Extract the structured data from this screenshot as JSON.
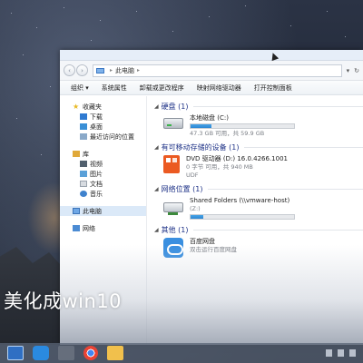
{
  "overlay_title": "美化成win10",
  "window": {
    "breadcrumb": [
      "此电脑"
    ],
    "toolbar": {
      "items": [
        "组织 ▾",
        "系统属性",
        "卸载或更改程序",
        "映射网络驱动器",
        "打开控制面板"
      ]
    },
    "sidebar": {
      "favorites": {
        "label": "收藏夹",
        "items": [
          "下载",
          "桌面",
          "最近访问的位置"
        ]
      },
      "libraries": {
        "label": "库",
        "items": [
          "视频",
          "图片",
          "文档",
          "音乐"
        ]
      },
      "this_pc": "此电脑",
      "network": "网络"
    },
    "main": {
      "hard_disks": {
        "header": "硬盘 (1)",
        "items": [
          {
            "name": "本地磁盘 (C:)",
            "usage_fraction": 0.2,
            "meta": "47.3 GB 可用，共 59.9 GB"
          }
        ]
      },
      "removable": {
        "header": "有可移动存储的设备 (1)",
        "items": [
          {
            "name": "DVD 驱动器 (D:) 16.0.4266.1001",
            "meta": "0 字节 可用，共 940 MB",
            "fs": "UDF",
            "usage_fraction": 1.0
          }
        ]
      },
      "network_locations": {
        "header": "网络位置 (1)",
        "items": [
          {
            "name": "Shared Folders (\\\\vmware-host)",
            "sub": "(Z:)",
            "usage_fraction": 0.12
          }
        ]
      },
      "other": {
        "header": "其他 (1)",
        "items": [
          {
            "name": "百度网盘",
            "sub": "双击运行百度网盘"
          }
        ]
      }
    }
  },
  "icons": {
    "back": "back-arrow-icon",
    "forward": "forward-arrow-icon",
    "refresh": "refresh-icon",
    "dropdown": "chevron-down-icon"
  },
  "colors": {
    "accent": "#2c86d3",
    "group_header": "#1e3287"
  }
}
